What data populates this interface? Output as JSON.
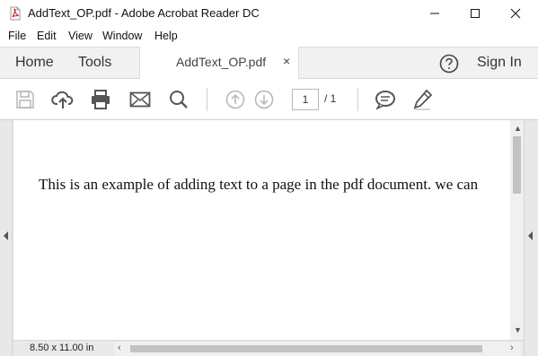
{
  "window": {
    "title": "AddText_OP.pdf - Adobe Acrobat Reader DC",
    "app_icon": "pdf-file-icon",
    "controls": [
      "minimize-icon",
      "maximize-icon",
      "close-icon"
    ]
  },
  "menu": {
    "items": [
      "File",
      "Edit",
      "View",
      "Window",
      "Help"
    ]
  },
  "tabs": {
    "home": "Home",
    "tools": "Tools",
    "document": "AddText_OP.pdf",
    "document_close": "×",
    "sign_in": "Sign In",
    "help_icon": "help-circle-icon"
  },
  "toolbar": {
    "icons": [
      "save-icon",
      "upload-cloud-icon",
      "print-icon",
      "email-icon",
      "search-icon",
      "previous-page-icon",
      "next-page-icon",
      "comment-icon",
      "sign-pen-icon"
    ],
    "current_page": "1",
    "page_total": "/ 1"
  },
  "document": {
    "text": "This is an example of adding text to a page in the pdf document. we can"
  },
  "status": {
    "page_size": "8.50 x 11.00 in"
  },
  "colors": {
    "pdf_red": "#d9262c",
    "toolbar_icon": "#555555",
    "disabled_icon": "#b5b5b5",
    "scroll_thumb": "#c2c2c2"
  }
}
